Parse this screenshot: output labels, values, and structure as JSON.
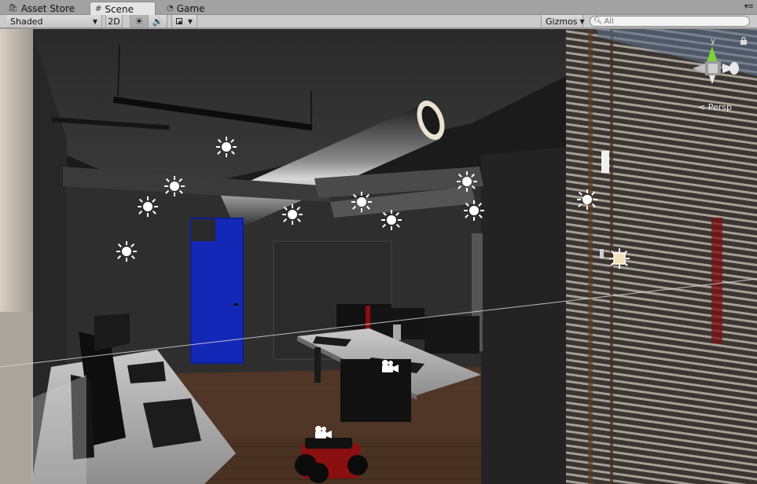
{
  "tabs": [
    {
      "label": "Asset Store",
      "icon": "shopping-bag-icon",
      "active": false
    },
    {
      "label": "Scene",
      "icon": "grid-hash-icon",
      "active": true
    },
    {
      "label": "Game",
      "icon": "pacman-icon",
      "active": false
    }
  ],
  "toolbar": {
    "shading_mode": "Shaded",
    "two_d_label": "2D",
    "lighting_icon": "sun-icon",
    "audio_icon": "speaker-icon",
    "effects_icon": "image-icon",
    "gizmos_label": "Gizmos",
    "search_placeholder": "All"
  },
  "scene": {
    "projection_label": "< Persp",
    "axis_label_y": "y",
    "accent_colors": {
      "door": "#1428b8",
      "robot": "#8a0f0f",
      "gizmo_y": "#7bd23a",
      "gizmo_x": "#c0c0c0"
    }
  }
}
